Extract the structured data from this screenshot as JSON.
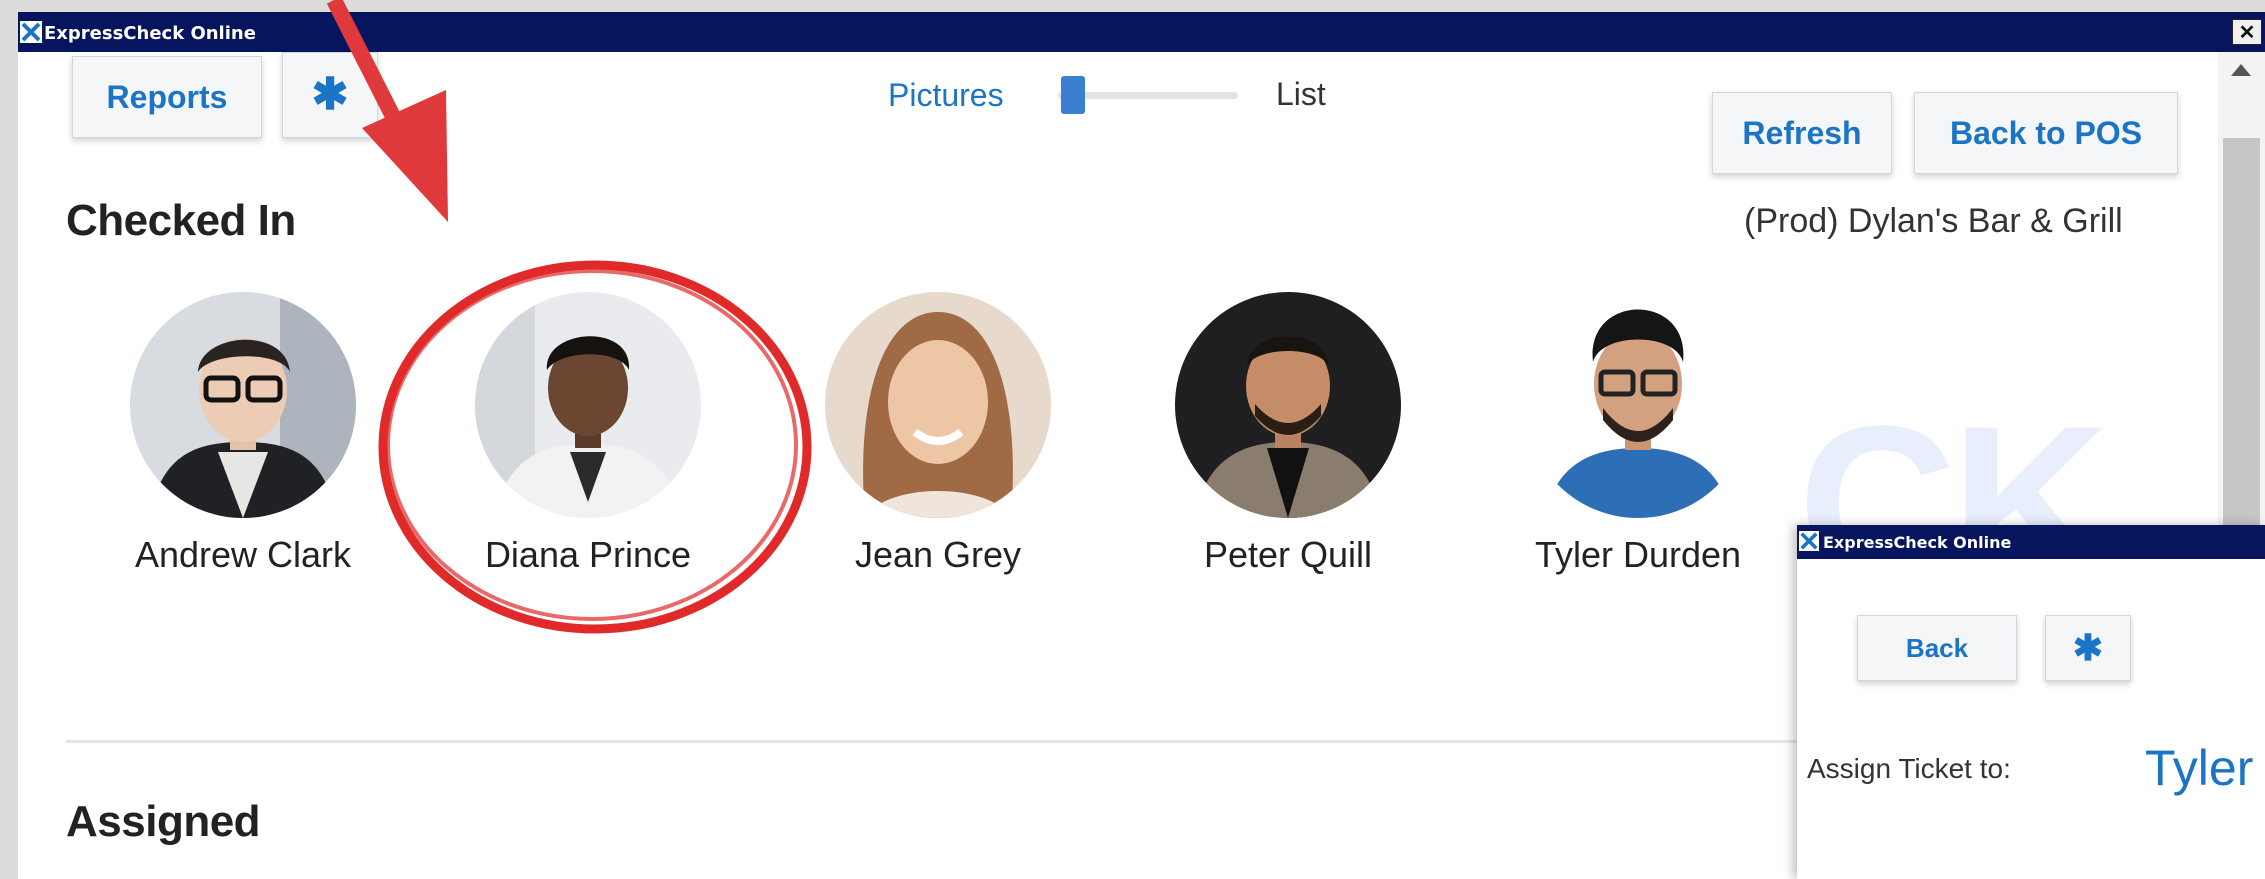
{
  "window": {
    "title": "ExpressCheck Online",
    "close_label": "✕"
  },
  "toolbar": {
    "reports_label": "Reports",
    "view_toggle": {
      "left_label": "Pictures",
      "right_label": "List",
      "selected": "Pictures"
    },
    "refresh_label": "Refresh",
    "back_to_pos_label": "Back to POS"
  },
  "store_name": "(Prod) Dylan's Bar & Grill",
  "checked_in": {
    "heading": "Checked In",
    "people": [
      {
        "name": "Andrew Clark"
      },
      {
        "name": "Diana Prince"
      },
      {
        "name": "Jean Grey"
      },
      {
        "name": "Peter Quill"
      },
      {
        "name": "Tyler Durden"
      }
    ]
  },
  "assigned": {
    "heading": "Assigned"
  },
  "watermark": "CK",
  "colors": {
    "title_bar": "#07155e",
    "accent": "#1b74c5",
    "annotation_red": "#e02a2a"
  },
  "dialog": {
    "title": "ExpressCheck Online",
    "back_label": "Back",
    "assign_label": "Assign Ticket to:",
    "assign_name": "Tyler"
  }
}
